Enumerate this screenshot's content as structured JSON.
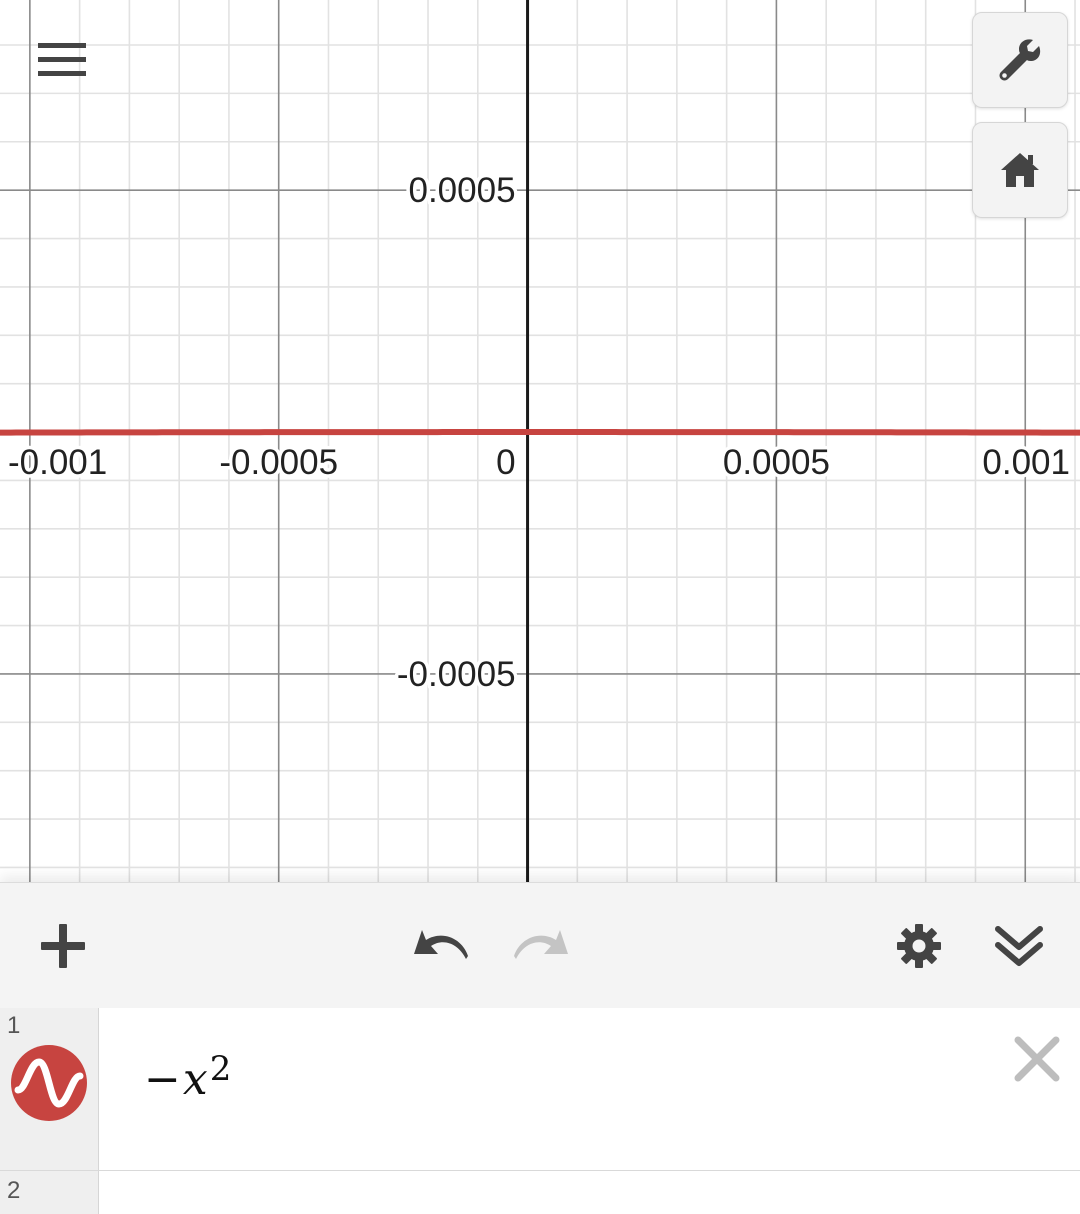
{
  "graph": {
    "x_range": [
      -0.00106,
      0.00111
    ],
    "y_range": [
      -0.00093,
      0.000893
    ],
    "major_step": 0.0005,
    "minor_step": 0.0001,
    "x_tick_labels": [
      {
        "value": -0.001,
        "label": "-0.001"
      },
      {
        "value": -0.0005,
        "label": "-0.0005"
      },
      {
        "value": 0,
        "label": "0"
      },
      {
        "value": 0.0005,
        "label": "0.0005"
      },
      {
        "value": 0.001,
        "label": "0.001"
      }
    ],
    "y_tick_labels": [
      {
        "value": 0.0005,
        "label": "0.0005"
      },
      {
        "value": -0.0005,
        "label": "-0.0005"
      }
    ],
    "curve_color": "#c74440",
    "grid_minor_color": "#e2e2e2",
    "grid_major_color": "#8a8a8a",
    "axis_color": "#1a1a1a"
  },
  "controls": {
    "menu_icon": "hamburger-icon",
    "wrench_icon": "wrench-icon",
    "home_icon": "home-icon"
  },
  "toolbar": {
    "add_icon": "plus-icon",
    "undo_icon": "undo-icon",
    "redo_icon": "redo-icon",
    "settings_icon": "gear-icon",
    "collapse_icon": "double-chevron-down-icon"
  },
  "expressions": [
    {
      "index": "1",
      "operator": "−",
      "variable": "x",
      "exponent": "2",
      "color": "#c74440"
    },
    {
      "index": "2"
    }
  ]
}
